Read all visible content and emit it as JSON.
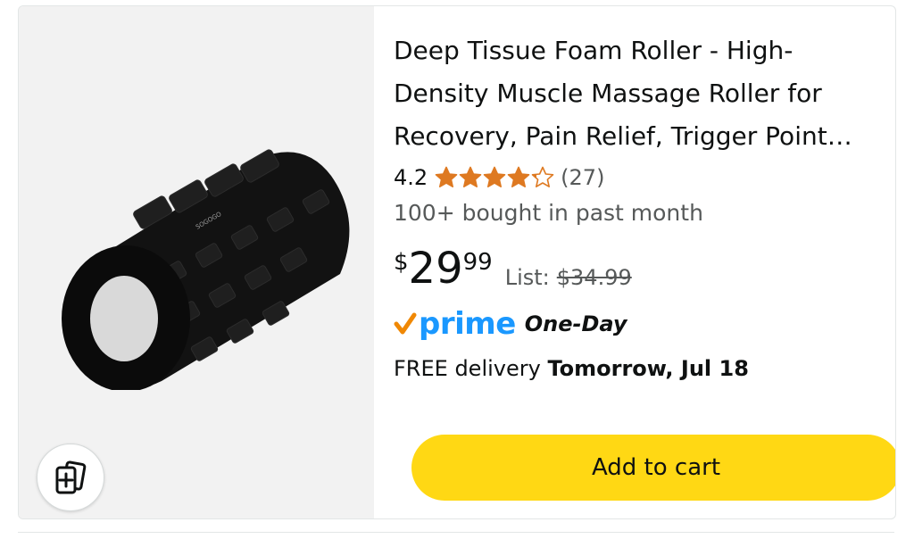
{
  "product": {
    "title": "Deep Tissue Foam Roller - High-Density Muscle Massage Roller for Recovery, Pain Relief, Trigger Point Therapy",
    "image_alt": "Black textured foam roller",
    "brand_on_image": "SOGOGO",
    "rating": "4.2",
    "rating_value": 4.2,
    "rating_max": 5,
    "rating_count": "(27)",
    "bought": "100+ bought in past month",
    "price": {
      "symbol": "$",
      "whole": "29",
      "fraction": "99",
      "list_label": "List:",
      "list_price": "$34.99"
    },
    "prime": {
      "logo_text": "prime",
      "badge": "One-Day"
    },
    "delivery": {
      "prefix": "FREE delivery",
      "date": "Tomorrow, Jul 18"
    },
    "add_to_cart_label": "Add to cart"
  },
  "colors": {
    "star": "#de7921",
    "prime_blue": "#1a98ff",
    "prime_check": "#f08804",
    "button": "#ffd814"
  },
  "icons": {
    "compare": "compare-cards-icon",
    "star": "star-icon",
    "prime_check": "prime-check-icon"
  }
}
